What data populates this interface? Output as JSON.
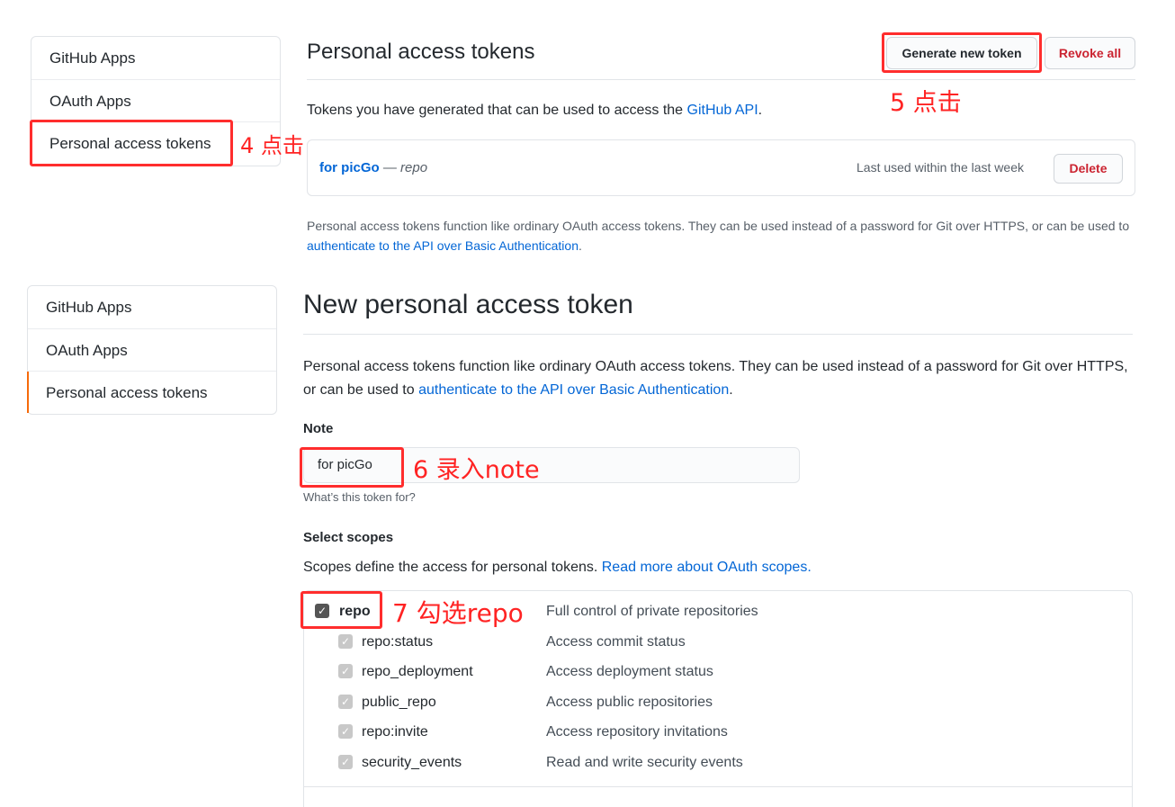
{
  "top": {
    "sidebar": [
      {
        "label": "GitHub Apps"
      },
      {
        "label": "OAuth Apps"
      },
      {
        "label": "Personal access tokens"
      }
    ],
    "title": "Personal access tokens",
    "generate_button": "Generate new token",
    "revoke_button": "Revoke all",
    "intro_text": "Tokens you have generated that can be used to access the ",
    "intro_link": "GitHub API",
    "intro_end": ".",
    "token": {
      "name": "for picGo",
      "separator": " — ",
      "scope": "repo",
      "last_used": "Last used within the last week",
      "delete_button": "Delete"
    },
    "footnote_text": "Personal access tokens function like ordinary OAuth access tokens. They can be used instead of a password for Git over HTTPS, or can be used to ",
    "footnote_link": "authenticate to the API over Basic Authentication",
    "footnote_end": "."
  },
  "annotations": {
    "step4": "4 点击",
    "step5": "5 点击",
    "step6": "6 录入note",
    "step7": "7 勾选repo"
  },
  "bottom": {
    "sidebar": [
      {
        "label": "GitHub Apps"
      },
      {
        "label": "OAuth Apps"
      },
      {
        "label": "Personal access tokens"
      }
    ],
    "title": "New personal access token",
    "desc_text": "Personal access tokens function like ordinary OAuth access tokens. They can be used instead of a password for Git over HTTPS, or can be used to ",
    "desc_link": "authenticate to the API over Basic Authentication",
    "desc_end": ".",
    "note_label": "Note",
    "note_value": "for picGo",
    "note_hint": "What’s this token for?",
    "scopes_label": "Select scopes",
    "scopes_text": "Scopes define the access for personal tokens. ",
    "scopes_link": "Read more about OAuth scopes.",
    "scopes": [
      {
        "name": "repo",
        "desc": "Full control of private repositories",
        "checked": true
      },
      {
        "name": "repo:status",
        "desc": "Access commit status",
        "checked": true
      },
      {
        "name": "repo_deployment",
        "desc": "Access deployment status",
        "checked": true
      },
      {
        "name": "public_repo",
        "desc": "Access public repositories",
        "checked": true
      },
      {
        "name": "repo:invite",
        "desc": "Access repository invitations",
        "checked": true
      },
      {
        "name": "security_events",
        "desc": "Read and write security events",
        "checked": true
      }
    ]
  },
  "colors": {
    "link": "#0366d6",
    "annotation_red": "#ff2d2d",
    "danger": "#cb2431",
    "active_bar": "#f66a0a"
  }
}
